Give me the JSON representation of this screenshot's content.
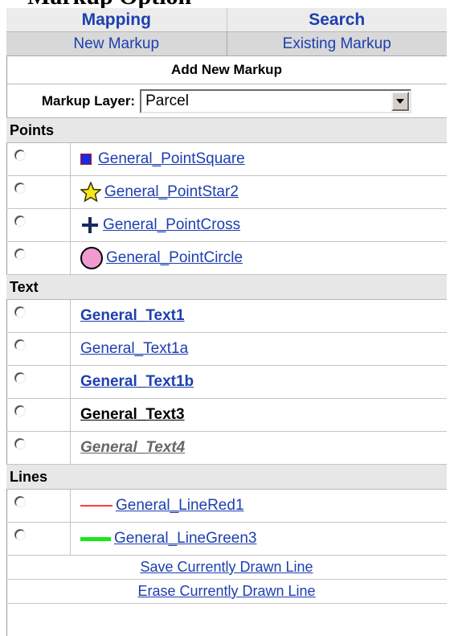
{
  "header": {
    "title_fragment": "Markup Option"
  },
  "tabs": [
    {
      "label": "Mapping"
    },
    {
      "label": "Search"
    }
  ],
  "subtabs": [
    {
      "label": "New Markup"
    },
    {
      "label": "Existing Markup"
    }
  ],
  "panel": {
    "heading": "Add New Markup"
  },
  "layer": {
    "label": "Markup Layer:",
    "selected": "Parcel"
  },
  "sections": {
    "points": {
      "title": "Points",
      "items": [
        {
          "label": "General_PointSquare",
          "icon": "square-icon"
        },
        {
          "label": "General_PointStar2",
          "icon": "star-icon"
        },
        {
          "label": "General_PointCross",
          "icon": "cross-icon"
        },
        {
          "label": "General_PointCircle",
          "icon": "circle-icon"
        }
      ]
    },
    "text": {
      "title": "Text",
      "items": [
        {
          "label": "General_Text1"
        },
        {
          "label": "General_Text1a"
        },
        {
          "label": "General_Text1b"
        },
        {
          "label": "General_Text3"
        },
        {
          "label": "General_Text4"
        }
      ]
    },
    "lines": {
      "title": "Lines",
      "items": [
        {
          "label": "General_LineRed1",
          "icon": "red-line-icon"
        },
        {
          "label": "General_LineGreen3",
          "icon": "green-line-icon"
        }
      ]
    }
  },
  "actions": {
    "save": "Save Currently Drawn Line",
    "erase": "Erase Currently Drawn Line"
  },
  "colors": {
    "link": "#1d3fb0",
    "point_square": "#1a2bd8",
    "point_star": "#f5e81a",
    "point_cross": "#1c2a5e",
    "point_circle": "#f09ad0",
    "line_red": "#ff3b3b",
    "line_green": "#17e817"
  }
}
